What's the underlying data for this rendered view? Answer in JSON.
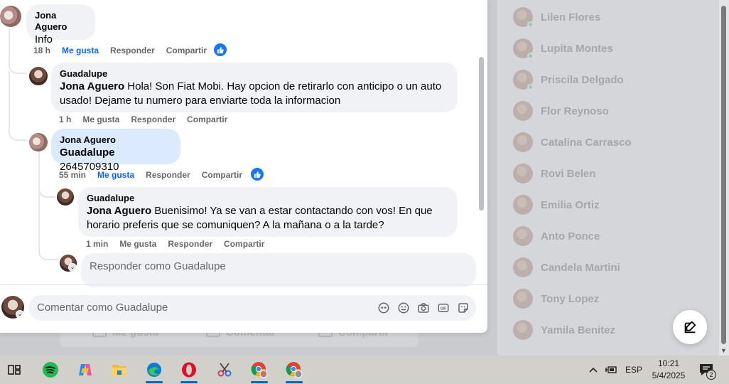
{
  "comments_panel": {
    "top_comment": {
      "author": "Jona Aguero",
      "text": "Info",
      "time": "18 h",
      "like_label": "Me gusta",
      "reply_label": "Responder",
      "share_label": "Compartir"
    },
    "reply_1": {
      "author": "Guadalupe",
      "mention": "Jona Aguero",
      "text_line1": " Hola! Son Fiat Mobi. Hay opcion de retirarlo con anticipo o un auto",
      "text_line2": "usado! Dejame tu numero para enviarte toda la informacion",
      "time": "1 h",
      "like_label": "Me gusta",
      "reply_label": "Responder",
      "share_label": "Compartir"
    },
    "reply_2": {
      "author": "Jona Aguero",
      "mention": "Guadalupe",
      "text": " 2645709310",
      "time": "55 min",
      "like_label": "Me gusta",
      "reply_label": "Responder",
      "share_label": "Compartir"
    },
    "reply_3": {
      "author": "Guadalupe",
      "mention": "Jona Aguero",
      "text_line1": " Buenisimo! Ya se van a estar contactando con vos! En que",
      "text_line2": "horario preferis que se comuniquen? A la mañana o a la tarde?",
      "time": "1 min",
      "like_label": "Me gusta",
      "reply_label": "Responder",
      "share_label": "Compartir"
    },
    "reply_placeholder": "Responder como Guadalupe",
    "comment_placeholder": "Comentar como Guadalupe"
  },
  "background_feed": {
    "actions": [
      "Me gusta",
      "Comentar",
      "Compartir"
    ]
  },
  "contacts_sidebar": {
    "contacts": [
      {
        "name": "Lilen Flores",
        "online": true
      },
      {
        "name": "Lupita Montes",
        "online": true
      },
      {
        "name": "Priscila Delgado",
        "online": true
      },
      {
        "name": "Flor Reynoso",
        "online": false
      },
      {
        "name": "Catalina Carrasco",
        "online": false
      },
      {
        "name": "Rovi Belen",
        "online": false
      },
      {
        "name": "Emilia Ortiz",
        "online": false
      },
      {
        "name": "Anto Ponce",
        "online": false
      },
      {
        "name": "Candela Martini",
        "online": false
      },
      {
        "name": "Tony Lopez",
        "online": false
      },
      {
        "name": "Yamila Benitez",
        "online": false
      }
    ]
  },
  "taskbar": {
    "apps": [
      "task-view",
      "spotify",
      "copilot",
      "file-explorer",
      "edge",
      "opera",
      "snipping-tool",
      "chrome-profile-1",
      "chrome-profile-2"
    ],
    "language": "ESP",
    "time": "10:21",
    "date": "5/4/2025",
    "notification_count": "2"
  },
  "colors": {
    "accent": "#0866ff",
    "like_blue": "#1877f2",
    "bubble": "#f0f2f5",
    "meta_text": "#65676b"
  }
}
